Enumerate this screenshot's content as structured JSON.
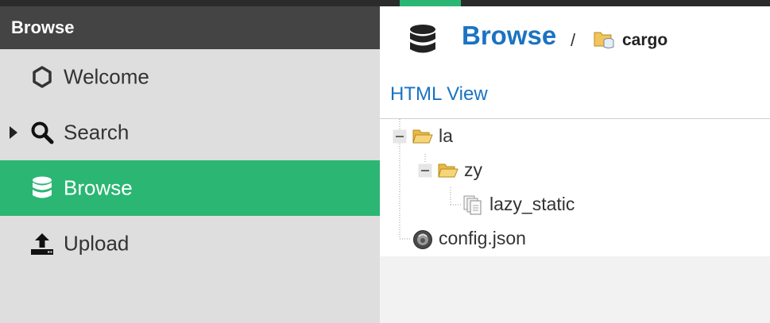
{
  "sidebar": {
    "header": "Browse",
    "items": [
      {
        "label": "Welcome",
        "icon": "hexagon-icon"
      },
      {
        "label": "Search",
        "icon": "search-icon"
      },
      {
        "label": "Browse",
        "icon": "database-icon"
      },
      {
        "label": "Upload",
        "icon": "upload-icon"
      }
    ]
  },
  "main": {
    "title": "Browse",
    "breadcrumb_separator": "/",
    "breadcrumb_current": "cargo",
    "html_view_link": "HTML View",
    "tree": [
      {
        "label": "la",
        "type": "folder-open",
        "expanded": true
      },
      {
        "label": "zy",
        "type": "folder-open",
        "expanded": true
      },
      {
        "label": "lazy_static",
        "type": "file-stack"
      },
      {
        "label": "config.json",
        "type": "json-file"
      }
    ]
  },
  "colors": {
    "accent": "#2bb673",
    "header_dark": "#444444",
    "link": "#1a73c2",
    "sidebar_bg": "#dedede"
  }
}
